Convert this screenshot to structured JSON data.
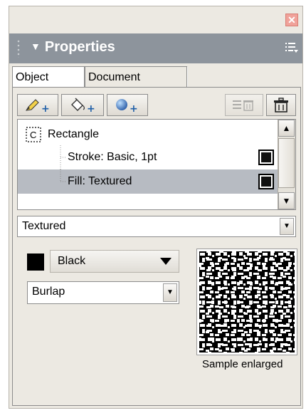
{
  "window": {
    "close_glyph": "✕"
  },
  "panel": {
    "title": "Properties",
    "collapse_icon": "triangle-down-icon",
    "menu_icon": "panel-options-menu-icon"
  },
  "tabs": [
    {
      "label": "Object",
      "active": true
    },
    {
      "label": "Document",
      "active": false
    }
  ],
  "toolbar": {
    "buttons": [
      {
        "name": "add-stroke-button",
        "icon": "pencil-plus-icon"
      },
      {
        "name": "add-fill-button",
        "icon": "paint-bucket-plus-icon"
      },
      {
        "name": "add-effect-button",
        "icon": "sphere-plus-icon"
      },
      {
        "name": "remove-attribute-button",
        "icon": "list-trash-icon",
        "enabled": false
      },
      {
        "name": "delete-button",
        "icon": "trash-icon"
      }
    ]
  },
  "attributes": {
    "object_badge": "C",
    "object_name": "Rectangle",
    "items": [
      {
        "label": "Stroke: Basic, 1pt",
        "selected": false,
        "swatch": "#000000"
      },
      {
        "label": "Fill: Textured",
        "selected": true,
        "swatch": "#000000"
      }
    ]
  },
  "fill_type": {
    "value": "Textured"
  },
  "color": {
    "value": "Black",
    "swatch": "#000000"
  },
  "texture": {
    "value": "Burlap"
  },
  "preview": {
    "caption": "Sample enlarged"
  }
}
